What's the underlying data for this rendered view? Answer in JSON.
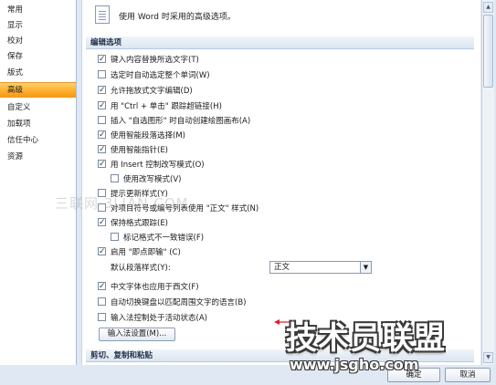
{
  "sidebar": {
    "items": [
      "常用",
      "显示",
      "校对",
      "保存",
      "版式",
      "高级",
      "自定义",
      "加载项",
      "信任中心",
      "资源"
    ],
    "active_index": 5
  },
  "header": {
    "text": "使用 Word 时采用的高级选项。"
  },
  "section_edit": {
    "title": "编辑选项"
  },
  "options": [
    {
      "label": "键入内容替换所选文字(T)",
      "checked": true
    },
    {
      "label": "选定时自动选定整个单词(W)",
      "checked": false
    },
    {
      "label": "允许拖放式文字编辑(D)",
      "checked": true
    },
    {
      "label": "用 \"Ctrl + 单击\" 跟踪超链接(H)",
      "checked": true
    },
    {
      "label": "插入 \"自选图形\" 时自动创建绘图画布(A)",
      "checked": false
    },
    {
      "label": "使用智能段落选择(M)",
      "checked": true
    },
    {
      "label": "使用智能指针(E)",
      "checked": true
    },
    {
      "label": "用 Insert 控制改写模式(O)",
      "checked": true
    },
    {
      "label": "使用改写模式(V)",
      "checked": false
    },
    {
      "label": "提示更新样式(Y)",
      "checked": false
    },
    {
      "label": "对项目符号或编号列表使用 \"正文\" 样式(N)",
      "checked": false
    },
    {
      "label": "保持格式跟踪(E)",
      "checked": true
    },
    {
      "label": "标记格式不一致错误(F)",
      "checked": false
    },
    {
      "label": "启用 \"即点即输\" (C)",
      "checked": true
    }
  ],
  "default_style": {
    "label": "默认段落样式(Y):",
    "value": "正文"
  },
  "options2": [
    {
      "label": "中文字体也应用于西文(F)",
      "checked": true
    },
    {
      "label": "自动切换键盘以匹配周围文字的语言(B)",
      "checked": false
    },
    {
      "label": "输入法控制处于活动状态(A)",
      "checked": false
    }
  ],
  "ime_settings_button": "输入法设置(M)...",
  "section_clipboard": {
    "title": "剪切、复制和粘贴"
  },
  "footer": {
    "ok": "确定",
    "cancel": "取消"
  },
  "watermark": {
    "middle": "三联网 3LIAN.COM"
  },
  "logo": {
    "title": "技术员联盟",
    "url": "www.jsgho.com"
  },
  "colors": {
    "active_tab": "#ffb02e",
    "arrow": "#d9232a",
    "panel_bg": "#dfe8f3"
  }
}
